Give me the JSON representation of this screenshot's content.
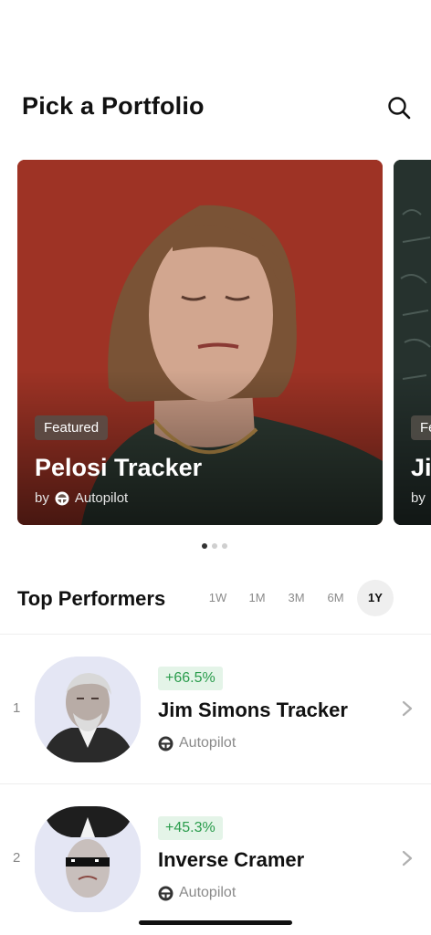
{
  "header": {
    "title": "Pick a Portfolio",
    "search_icon": "search-icon"
  },
  "carousel": {
    "cards": [
      {
        "badge": "Featured",
        "title": "Pelosi Tracker",
        "by": "by",
        "author": "Autopilot",
        "author_icon": "steering-wheel-icon",
        "bg_color": "#9c3224"
      },
      {
        "badge": "Fe",
        "title": "Ji",
        "by": "by",
        "bg_color": "#27332f"
      }
    ],
    "active_index": 0,
    "dot_count": 3
  },
  "top_performers": {
    "title": "Top Performers",
    "ranges": [
      "1W",
      "1M",
      "3M",
      "6M",
      "1Y"
    ],
    "selected_range": "1Y",
    "items": [
      {
        "rank": "1",
        "change": "+66.5%",
        "name": "Jim Simons Tracker",
        "author": "Autopilot"
      },
      {
        "rank": "2",
        "change": "+45.3%",
        "name": "Inverse Cramer",
        "author": "Autopilot"
      }
    ]
  },
  "colors": {
    "positive": "#2a9c4c",
    "positive_bg": "#e4f4e8",
    "accent_card": "#9c3224"
  }
}
